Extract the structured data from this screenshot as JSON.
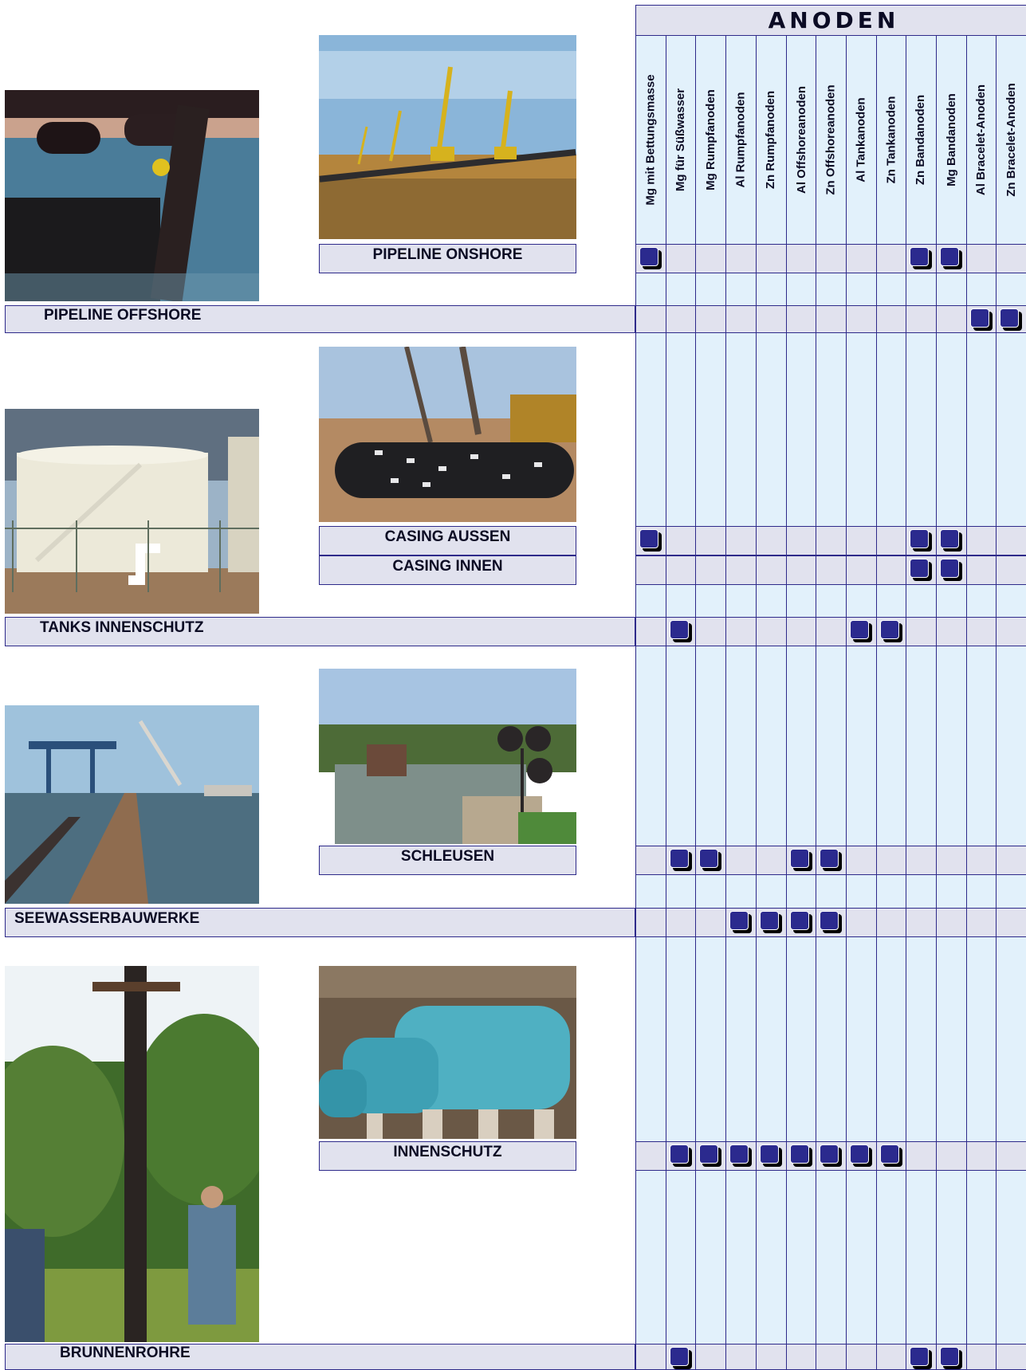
{
  "header": {
    "title": "ANODEN"
  },
  "columns": [
    "Mg  mit Bettungsmasse",
    "Mg für Süßwasser",
    "Mg Rumpfanoden",
    "Al Rumpfanoden",
    "Zn Rumpfanoden",
    "Al Offshoreanoden",
    "Zn Offshoreanoden",
    "Al Tankanoden",
    "Zn Tankanoden",
    "Zn Bandanoden",
    "Mg Bandanoden",
    "Al Bracelet-Anoden",
    "Zn Bracelet-Anoden"
  ],
  "rows": [
    {
      "label": "PIPELINE ONSHORE",
      "marks": [
        0,
        9,
        10
      ]
    },
    {
      "label": "PIPELINE OFFSHORE",
      "marks": [
        11,
        12
      ]
    },
    {
      "label": "CASING AUSSEN",
      "marks": [
        0,
        9,
        10
      ]
    },
    {
      "label": "CASING INNEN",
      "marks": [
        9,
        10
      ]
    },
    {
      "label": "TANKS INNENSCHUTZ",
      "marks": [
        1,
        7,
        8
      ]
    },
    {
      "label": "SCHLEUSEN",
      "marks": [
        1,
        2,
        5,
        6
      ]
    },
    {
      "label": "SEEWASSERBAUWERKE",
      "marks": [
        3,
        4,
        5,
        6
      ]
    },
    {
      "label": "INNENSCHUTZ",
      "marks": [
        1,
        2,
        3,
        4,
        5,
        6,
        7,
        8
      ]
    },
    {
      "label": "BRUNNENROHRE",
      "marks": [
        1,
        9,
        10
      ]
    }
  ]
}
